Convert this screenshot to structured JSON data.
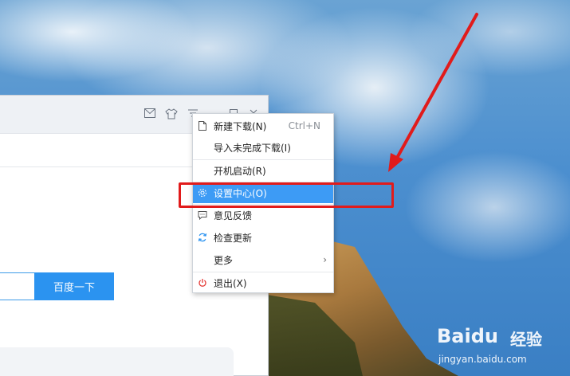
{
  "app_window": {
    "titlebar_icons": [
      "mail-icon",
      "skin-icon",
      "menu-icon",
      "minimize-icon",
      "maximize-icon",
      "close-icon"
    ],
    "search_button_label": "百度一下"
  },
  "context_menu": {
    "items": [
      {
        "label": "新建下载(N)",
        "shortcut": "Ctrl+N",
        "icon": "new-file-icon"
      },
      {
        "label": "导入未完成下载(I)"
      },
      {
        "label": "开机启动(R)"
      },
      {
        "label": "设置中心(O)",
        "icon": "gear-icon",
        "highlighted": true
      },
      {
        "label": "意见反馈",
        "icon": "feedback-icon"
      },
      {
        "label": "检查更新",
        "icon": "refresh-icon"
      },
      {
        "label": "更多",
        "submenu": true
      },
      {
        "label": "退出(X)",
        "icon": "power-icon"
      }
    ]
  },
  "annotation": {
    "color": "#e11b1b"
  },
  "watermark": {
    "brand": "Baidu",
    "product": "经验",
    "url": "jingyan.baidu.com"
  },
  "colors": {
    "menu_highlight": "#3d9bf5",
    "search_button": "#2b93f0",
    "power_icon": "#e53935",
    "refresh_icon": "#2b93f0"
  }
}
